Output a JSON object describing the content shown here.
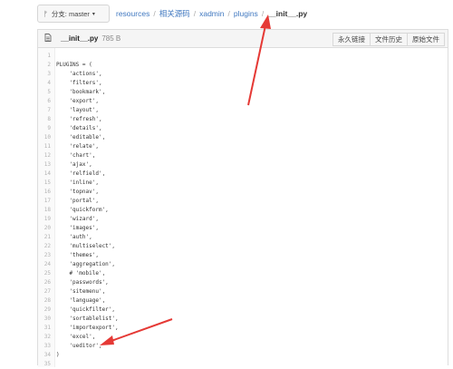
{
  "branch": {
    "label": "分支: master",
    "icon": "git-branch-icon",
    "caret": "▾"
  },
  "breadcrumb": {
    "items": [
      "resources",
      "相关源码",
      "xadmin",
      "plugins"
    ],
    "separator": "/",
    "current": "__init__.py"
  },
  "file": {
    "icon": "file-icon",
    "name": "__init__.py",
    "size": "785 B",
    "actions": [
      "永久链接",
      "文件历史",
      "原始文件"
    ]
  },
  "code": {
    "lines": [
      {
        "n": "1",
        "t": ""
      },
      {
        "n": "2",
        "t": "PLUGINS = ("
      },
      {
        "n": "3",
        "t": "    'actions',"
      },
      {
        "n": "4",
        "t": "    'filters',"
      },
      {
        "n": "5",
        "t": "    'bookmark',"
      },
      {
        "n": "6",
        "t": "    'export',"
      },
      {
        "n": "7",
        "t": "    'layout',"
      },
      {
        "n": "8",
        "t": "    'refresh',"
      },
      {
        "n": "9",
        "t": "    'details',"
      },
      {
        "n": "10",
        "t": "    'editable',"
      },
      {
        "n": "11",
        "t": "    'relate',"
      },
      {
        "n": "12",
        "t": "    'chart',"
      },
      {
        "n": "13",
        "t": "    'ajax',"
      },
      {
        "n": "14",
        "t": "    'relfield',"
      },
      {
        "n": "15",
        "t": "    'inline',"
      },
      {
        "n": "16",
        "t": "    'topnav',"
      },
      {
        "n": "17",
        "t": "    'portal',"
      },
      {
        "n": "18",
        "t": "    'quickform',"
      },
      {
        "n": "19",
        "t": "    'wizard',"
      },
      {
        "n": "20",
        "t": "    'images',"
      },
      {
        "n": "21",
        "t": "    'auth',"
      },
      {
        "n": "22",
        "t": "    'multiselect',"
      },
      {
        "n": "23",
        "t": "    'themes',"
      },
      {
        "n": "24",
        "t": "    'aggregation',"
      },
      {
        "n": "25",
        "t": "    # 'mobile',"
      },
      {
        "n": "26",
        "t": "    'passwords',"
      },
      {
        "n": "27",
        "t": "    'sitemenu',"
      },
      {
        "n": "28",
        "t": "    'language',"
      },
      {
        "n": "29",
        "t": "    'quickfilter',"
      },
      {
        "n": "30",
        "t": "    'sortablelist',"
      },
      {
        "n": "31",
        "t": "    'importexport',"
      },
      {
        "n": "32",
        "t": "    'excel',"
      },
      {
        "n": "33",
        "t": "    'ueditor',"
      },
      {
        "n": "34",
        "t": ")"
      },
      {
        "n": "35",
        "t": ""
      }
    ]
  },
  "annotation_color": "#e53935"
}
